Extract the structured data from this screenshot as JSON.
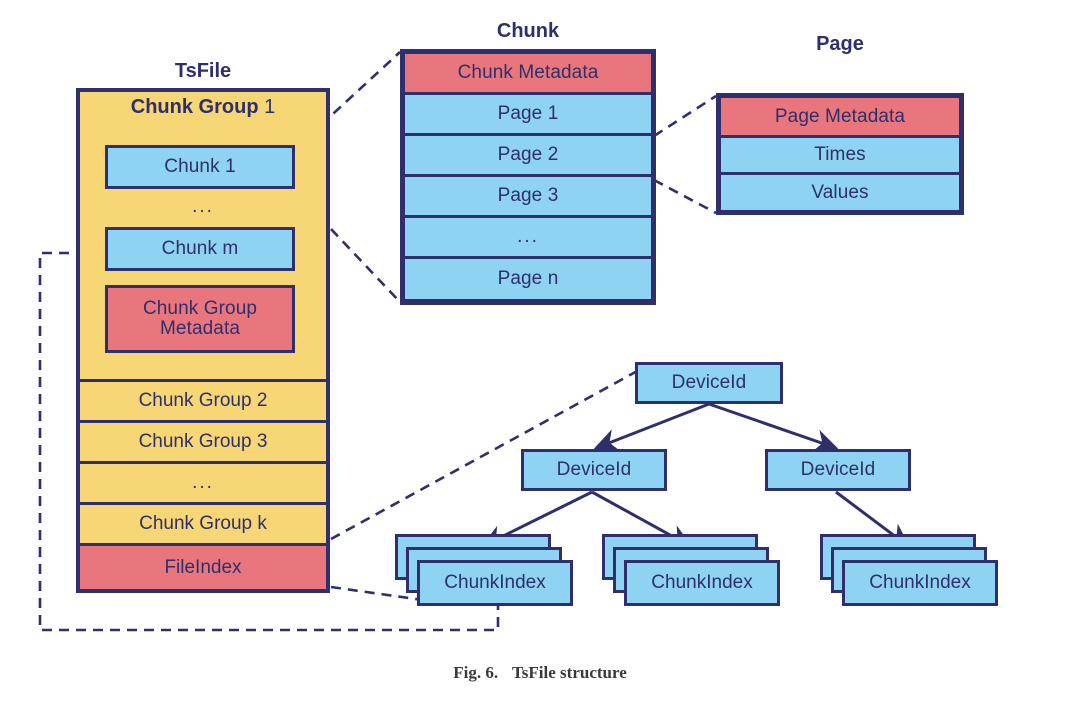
{
  "figure": {
    "caption_label": "Fig. 6.",
    "caption_text": "TsFile structure"
  },
  "colors": {
    "blue": "#8ed3f4",
    "yellow": "#f6d675",
    "red": "#e9767d",
    "outline": "#2e2f6b",
    "background": "#ffffff"
  },
  "columns": {
    "tsfile": {
      "title": "TsFile",
      "chunk_group_1": {
        "label": "Chunk Group",
        "number": "1",
        "items": [
          {
            "label": "Chunk 1",
            "color": "blue"
          },
          {
            "label": "...",
            "color": "none"
          },
          {
            "label": "Chunk m",
            "color": "blue"
          },
          {
            "label": "Chunk Group Metadata",
            "color": "red"
          }
        ]
      },
      "rows": [
        {
          "label": "Chunk Group 2",
          "color": "yellow"
        },
        {
          "label": "Chunk Group 3",
          "color": "yellow"
        },
        {
          "label": "...",
          "color": "yellow"
        },
        {
          "label": "Chunk Group k",
          "color": "yellow"
        },
        {
          "label": "FileIndex",
          "color": "red"
        }
      ]
    },
    "chunk": {
      "title": "Chunk",
      "rows": [
        {
          "label": "Chunk Metadata",
          "color": "red"
        },
        {
          "label": "Page 1",
          "color": "blue"
        },
        {
          "label": "Page 2",
          "color": "blue"
        },
        {
          "label": "Page 3",
          "color": "blue"
        },
        {
          "label": "...",
          "color": "blue"
        },
        {
          "label": "Page n",
          "color": "blue"
        }
      ]
    },
    "page": {
      "title": "Page",
      "rows": [
        {
          "label": "Page Metadata",
          "color": "red"
        },
        {
          "label": "Times",
          "color": "blue"
        },
        {
          "label": "Values",
          "color": "blue"
        }
      ]
    }
  },
  "index_tree": {
    "root": {
      "label": "DeviceId"
    },
    "level2": [
      {
        "label": "DeviceId"
      },
      {
        "label": "DeviceId"
      }
    ],
    "leaves": [
      {
        "label": "ChunkIndex"
      },
      {
        "label": "ChunkIndex"
      },
      {
        "label": "ChunkIndex"
      }
    ]
  }
}
